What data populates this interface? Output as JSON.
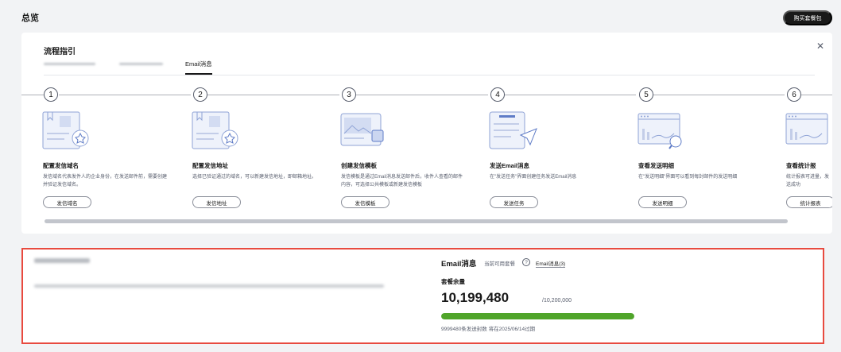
{
  "header": {
    "title": "总览",
    "buy_button": "购买套餐包"
  },
  "guide": {
    "title": "流程指引",
    "close_icon": "close-icon",
    "tabs": [
      {
        "label": "",
        "blurred": true
      },
      {
        "label": "",
        "blurred": true
      },
      {
        "label": "Email消息",
        "active": true
      }
    ],
    "steps": [
      {
        "num": "1",
        "title": "配置发信域名",
        "desc": "发信域名代表发件人的企业身份，在发送邮件前，需要创建并验证发信域名。",
        "button": "发信域名",
        "icon": "domain-certificate-icon"
      },
      {
        "num": "2",
        "title": "配置发信地址",
        "desc": "选择已验证通过的域名，可以新建发信地址，即邮箱地址。",
        "button": "发信地址",
        "icon": "address-certificate-icon"
      },
      {
        "num": "3",
        "title": "创建发信模板",
        "desc": "发信模板是通过Email消息发送邮件后，收件人查看的邮件内容，可选择公共模板或新建发信模板",
        "button": "发信模板",
        "icon": "template-image-icon"
      },
      {
        "num": "4",
        "title": "发送Email消息",
        "desc": "在\"发送任务\"界面创建任务发送Email消息",
        "button": "发送任务",
        "icon": "send-email-icon"
      },
      {
        "num": "5",
        "title": "查看发送明细",
        "desc": "在\"发送明细\"界面可以看到每封邮件的发送明细",
        "button": "发送明细",
        "icon": "detail-search-icon"
      },
      {
        "num": "6",
        "title": "查看统计报",
        "desc": "统计报表可进量，发送成功",
        "button": "统计报表",
        "icon": "statistics-chart-icon"
      }
    ]
  },
  "package": {
    "type": "Email消息",
    "avail_label": "当前可用套餐",
    "help_icon": "help-icon",
    "avail_link": "Email消息(3)",
    "remain_label": "套餐余量",
    "remain_value": "10,199,480",
    "total_value": "/10,200,000",
    "usage_fraction": 0.99995,
    "expire_text": "9999480条发送封数 将在2025/06/14过期",
    "colors": {
      "progress": "#50a52a",
      "highlight_border": "#e84a3f"
    }
  }
}
